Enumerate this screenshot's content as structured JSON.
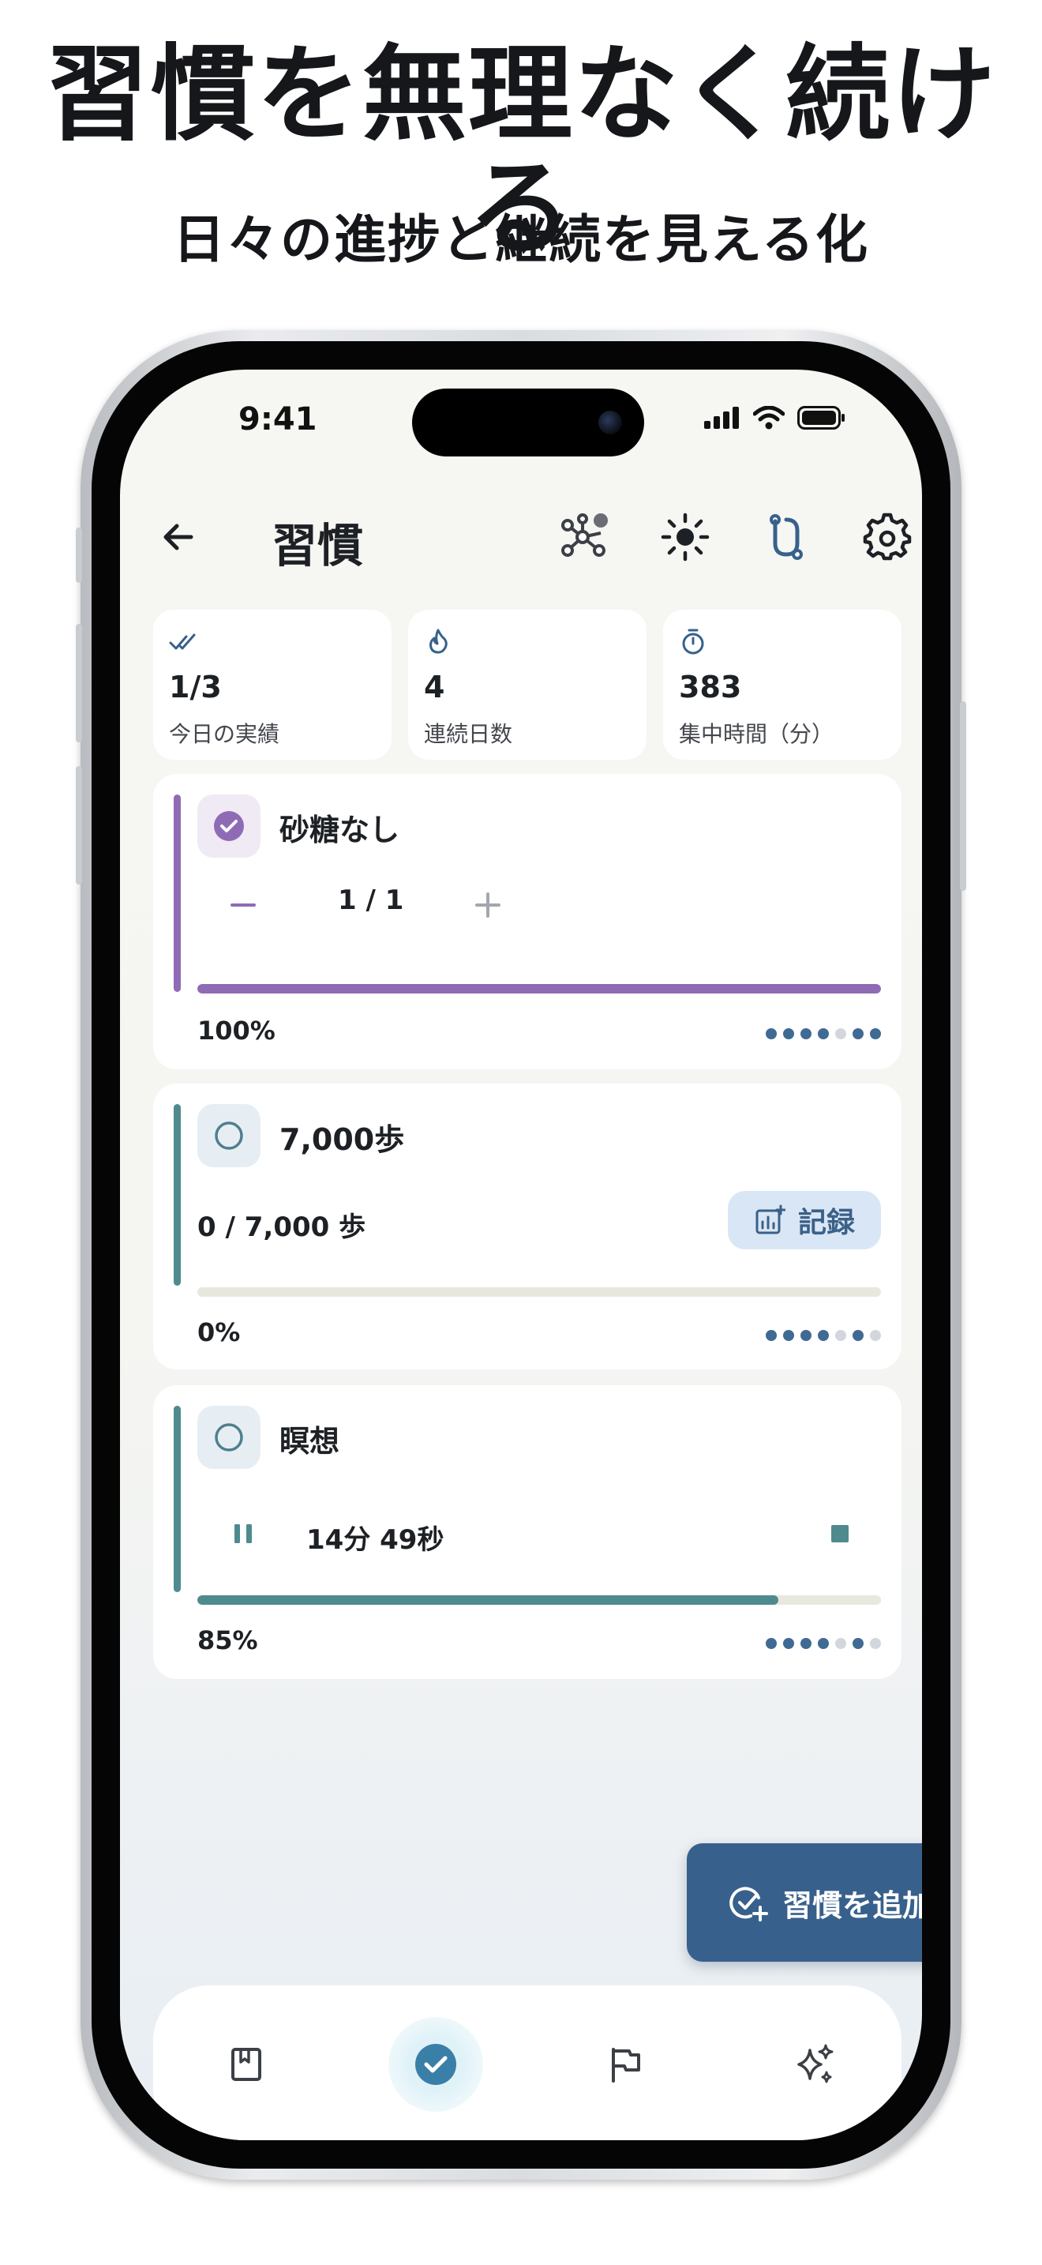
{
  "promo": {
    "headline": "習慣を無理なく続ける",
    "subheadline": "日々の進捗と継続を見える化"
  },
  "status_bar": {
    "time": "9:41"
  },
  "app_bar": {
    "title": "習慣"
  },
  "stats": [
    {
      "icon": "double-check-icon",
      "value": "1/3",
      "label": "今日の実績"
    },
    {
      "icon": "flame-icon",
      "value": "4",
      "label": "連続日数"
    },
    {
      "icon": "stopwatch-icon",
      "value": "383",
      "label": "集中時間（分）"
    }
  ],
  "habits": [
    {
      "name": "砂糖なし",
      "done": true,
      "accent": "#8f6bb5",
      "counter": "1 / 1",
      "progress": 1.0,
      "percent": "100%",
      "streak_dots": [
        1,
        1,
        1,
        1,
        0,
        1,
        1
      ]
    },
    {
      "name": "7,000歩",
      "done": false,
      "accent": "#4f8a8e",
      "amount": "0 / 7,000 歩",
      "record_label": "記録",
      "progress": 0.0,
      "percent": "0%",
      "streak_dots": [
        1,
        1,
        1,
        1,
        0,
        1,
        0
      ]
    },
    {
      "name": "瞑想",
      "done": false,
      "accent": "#4f8a8e",
      "timer": "14分 49秒",
      "progress": 0.85,
      "percent": "85%",
      "streak_dots": [
        1,
        1,
        1,
        1,
        0,
        1,
        0
      ]
    }
  ],
  "fab": {
    "label": "習慣を追加"
  },
  "colors": {
    "primary": "#37618c",
    "dot_on": "#3f6a94",
    "dot_off": "#d3d7dd",
    "purple": "#8f6bb5",
    "teal": "#4f8a8e"
  }
}
